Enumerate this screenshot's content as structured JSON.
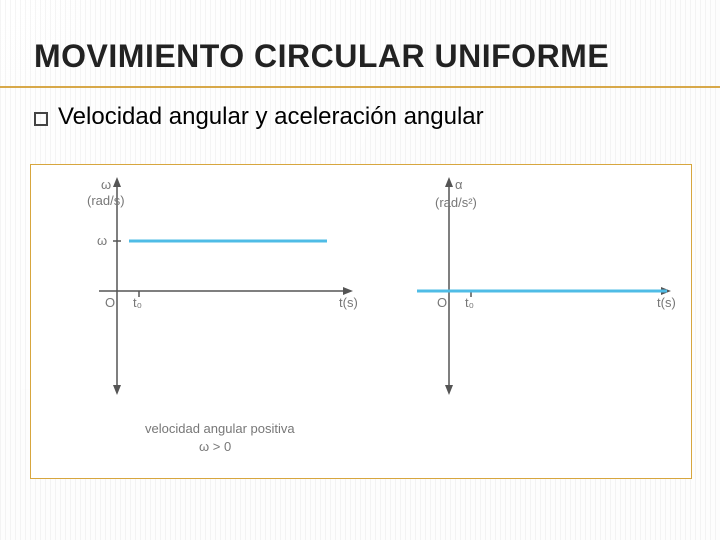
{
  "title": "MOVIMIENTO CIRCULAR UNIFORME",
  "bullet": "Velocidad angular y aceleración angular",
  "chart_data": [
    {
      "type": "line",
      "title": "",
      "xlabel": "t(s)",
      "ylabel_lines": [
        "ω",
        "(rad/s)"
      ],
      "y_tick": "ω",
      "x_origin": "O",
      "x_t0": "t₀",
      "series": [
        {
          "name": "ω(t)",
          "value": "ω",
          "constant": true,
          "color": "#4fbce6"
        }
      ],
      "caption_lines": [
        "velocidad angular positiva",
        "ω > 0"
      ],
      "xlim": [
        0,
        1
      ],
      "ylim": [
        -1,
        1
      ]
    },
    {
      "type": "line",
      "title": "",
      "xlabel": "t(s)",
      "ylabel_lines": [
        "α",
        "(rad/s²)"
      ],
      "y_tick": "",
      "x_origin": "O",
      "x_t0": "t₀",
      "series": [
        {
          "name": "α(t)",
          "value": 0,
          "constant": true,
          "color": "#4fbce6"
        }
      ],
      "caption_lines": [],
      "xlim": [
        0,
        1
      ],
      "ylim": [
        -1,
        1
      ]
    }
  ]
}
